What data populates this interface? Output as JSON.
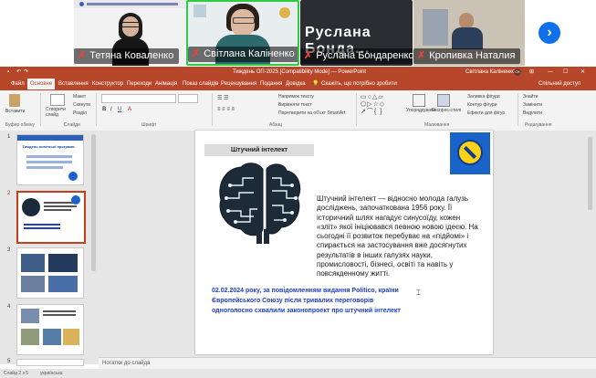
{
  "video": {
    "participants": [
      {
        "name": "Тетяна  Коваленко"
      },
      {
        "name": "Світлана Каліненко"
      },
      {
        "name": "Руслана Бондаренко"
      },
      {
        "name": "Кропивка Наталия"
      }
    ],
    "big_name": "Руслана  Бонда..."
  },
  "ppt": {
    "title": "Тиждень ОП-2025 [Compatibility Mode] — PowerPoint",
    "user": "Світлана Каліненко",
    "user_initials": "СК",
    "tabs": [
      "Файл",
      "Основне",
      "Вставлення",
      "Конструктор",
      "Переходи",
      "Анімація",
      "Показ слайдів",
      "Рецензування",
      "Подання",
      "Довідка"
    ],
    "active_tab": "Основне",
    "tell_me": "Скажіть, що потрібно зробити",
    "share": "Спільний доступ",
    "ribbon": {
      "paste": "Вставити",
      "clipboard": "Буфер обміну",
      "new_slide": "Створити слайд",
      "layout": "Макет",
      "reset": "Скинути",
      "section": "Розділ",
      "slides": "Слайди",
      "font": "Шрифт",
      "paragraph": "Абзац",
      "text_direction": "Напрямок тексту",
      "align_text": "Вирівняти текст",
      "smartart": "Перетворити на об'єкт SmartArt",
      "drawing": "Малювання",
      "arrange": "Упорядкувати",
      "styles": "Експрес-стилі",
      "fill": "Заливка фігури",
      "outline": "Контур фігури",
      "effects": "Ефекти для фігур",
      "find": "Знайти",
      "replace": "Замінити",
      "select": "Виділити",
      "editing": "Редагування"
    },
    "thumbnails": [
      {
        "num": "1",
        "title": "Тиждень освітньої програми"
      },
      {
        "num": "2"
      },
      {
        "num": "3"
      },
      {
        "num": "4"
      },
      {
        "num": "5"
      }
    ],
    "slide": {
      "header": "Штучний інтелект",
      "body": "Штучний інтелект — відносно молода галузь досліджень, започаткована 1956 року. Її історичний шлях нагадує синусоїду, кожен «зліт» якої ініціювався певною новою ідеєю. На сьогодні її розвиток перебуває на «підйомі» і спирається на застосування вже досягнутих результатів в інших галузях науки, промисловості, бізнесі, освіті та навіть у повсякденному житті.",
      "highlight": "02.02.2024 року, за повідомленням видання Politico, країни Європейського Союзу після тривалих переговорів одноголосно схвалили законопроект про штучний інтелект"
    },
    "notes": "Нотатки до слайда",
    "status_left": "Слайд 2 з 5",
    "status_lang": "українська",
    "zoom": "",
    "colors": {
      "accent": "#b7472a",
      "slide_text": "#1a1a1a",
      "highlight_text": "#1f3fbf",
      "logo_bg": "#1a63c9"
    }
  }
}
